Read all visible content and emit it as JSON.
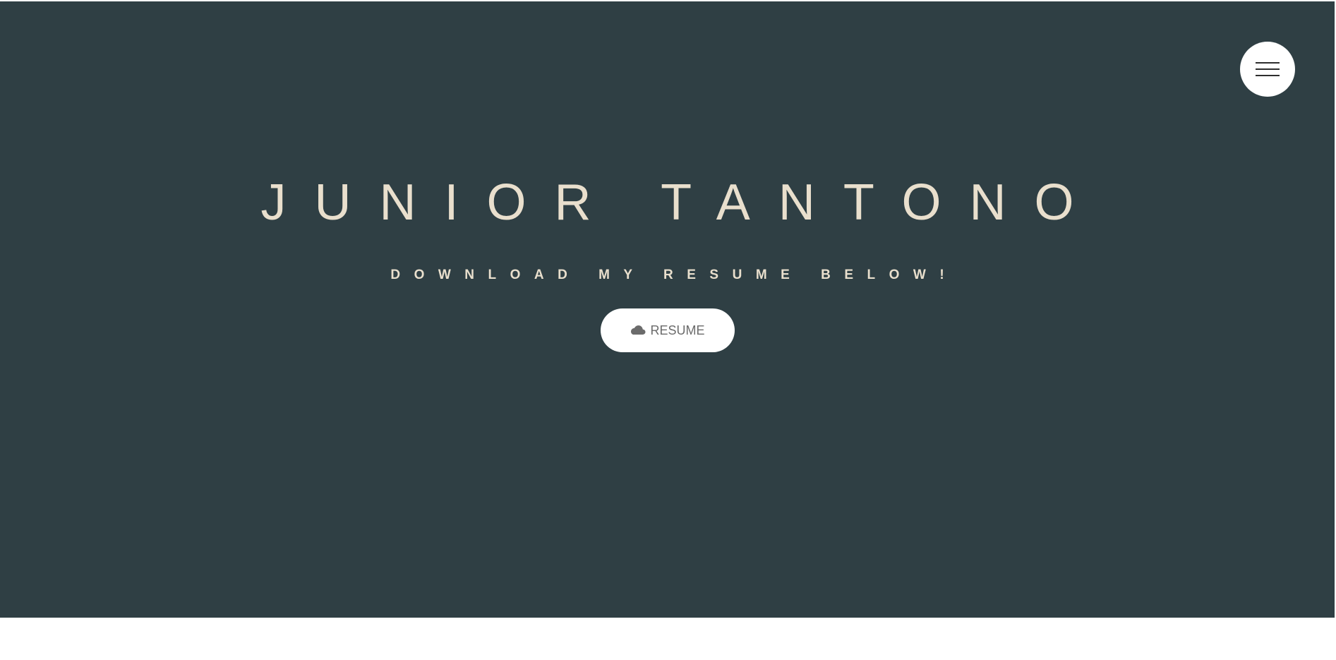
{
  "hero": {
    "title": "JUNIOR TANTONO",
    "subtitle": "DOWNLOAD MY RESUME BELOW!",
    "background_color": "#2f3f44",
    "text_color": "#e9dfcd"
  },
  "menu_button": {
    "icon": "hamburger-menu-icon"
  },
  "resume_button": {
    "label": "RESUME",
    "icon": "cloud-icon"
  }
}
